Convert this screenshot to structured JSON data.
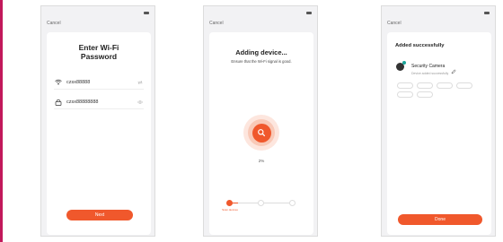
{
  "colors": {
    "accent": "#f0582c",
    "side_bar": "#c2185b",
    "teal": "#1aa59a"
  },
  "screens": [
    {
      "status": {
        "left": "",
        "right": ""
      },
      "cancel": "Cancel",
      "title_line1": "Enter Wi-Fi",
      "title_line2": "Password",
      "ssid": "czsx88888",
      "password": "czsx88888888",
      "next_label": "Next",
      "icons": {
        "ssid": "wifi-icon",
        "password": "lock-icon",
        "ssid_trail": "switch-icon",
        "password_trail": "eye-icon"
      }
    },
    {
      "status": {
        "left": "",
        "right": ""
      },
      "cancel": "Cancel",
      "title": "Adding device...",
      "subtitle": "Ensure that the Wi-Fi signal is good.",
      "progress_text": "2%",
      "progress": 0.02,
      "steps": [
        {
          "label": "Scan devices"
        },
        {
          "label": ""
        },
        {
          "label": ""
        }
      ]
    },
    {
      "status": {
        "left": "",
        "right": ""
      },
      "cancel": "Cancel",
      "title": "Added successfully",
      "device_name": "Security Camera",
      "device_status": "Device added successfully",
      "rooms": [
        "",
        "",
        "",
        "",
        "",
        ""
      ],
      "done_label": "Done"
    }
  ]
}
